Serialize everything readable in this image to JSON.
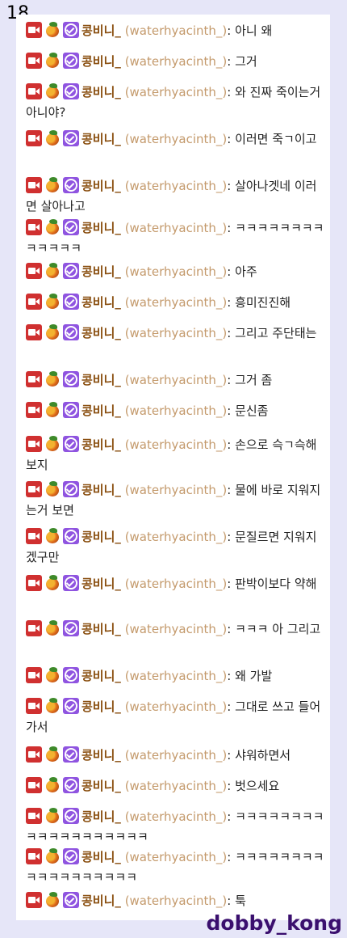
{
  "page_number": "18",
  "watermark": "dobby_kong",
  "colors": {
    "username": "#8a4f10",
    "login": "#c49a6c",
    "panel": "#ffffff",
    "background": "#e6e6f8"
  },
  "badges": [
    "camera-badge-icon",
    "fruit-badge-icon",
    "verified-badge-icon"
  ],
  "messages": [
    {
      "name": "콩비니_",
      "login": "(waterhyacinth_)",
      "text": "아니 왜"
    },
    {
      "name": "콩비니_",
      "login": "(waterhyacinth_)",
      "text": "그거"
    },
    {
      "name": "콩비니_",
      "login": "(waterhyacinth_)",
      "text": "와 진짜 죽이는거아니야?"
    },
    {
      "name": "콩비니_",
      "login": "(waterhyacinth_)",
      "text": "이러면 죽ㄱ이고"
    },
    {
      "name": "콩비니_",
      "login": "(waterhyacinth_)",
      "text": "살아나겟네 이러면 살아나고"
    },
    {
      "name": "콩비니_",
      "login": "(waterhyacinth_)",
      "text": "ㅋㅋㅋㅋㅋㅋㅋㅋㅋㅋㅋㅋㅋ"
    },
    {
      "name": "콩비니_",
      "login": "(waterhyacinth_)",
      "text": "아주"
    },
    {
      "name": "콩비니_",
      "login": "(waterhyacinth_)",
      "text": "흥미진진해"
    },
    {
      "name": "콩비니_",
      "login": "(waterhyacinth_)",
      "text": "그리고 주단태는"
    },
    {
      "name": "콩비니_",
      "login": "(waterhyacinth_)",
      "text": "그거 좀"
    },
    {
      "name": "콩비니_",
      "login": "(waterhyacinth_)",
      "text": "문신좀"
    },
    {
      "name": "콩비니_",
      "login": "(waterhyacinth_)",
      "text": "손으로 슥ㄱ슥해보지"
    },
    {
      "name": "콩비니_",
      "login": "(waterhyacinth_)",
      "text": "물에 바로 지워지는거 보면"
    },
    {
      "name": "콩비니_",
      "login": "(waterhyacinth_)",
      "text": "문질르면 지워지겠구만"
    },
    {
      "name": "콩비니_",
      "login": "(waterhyacinth_)",
      "text": "판박이보다 약해"
    },
    {
      "name": "콩비니_",
      "login": "(waterhyacinth_)",
      "text": "ㅋㅋㅋ 아 그리고"
    },
    {
      "name": "콩비니_",
      "login": "(waterhyacinth_)",
      "text": "왜 가발"
    },
    {
      "name": "콩비니_",
      "login": "(waterhyacinth_)",
      "text": "그대로 쓰고 들어가서"
    },
    {
      "name": "콩비니_",
      "login": "(waterhyacinth_)",
      "text": "샤워하면서"
    },
    {
      "name": "콩비니_",
      "login": "(waterhyacinth_)",
      "text": "벗으세요"
    },
    {
      "name": "콩비니_",
      "login": "(waterhyacinth_)",
      "text": "ㅋㅋㅋㅋㅋㅋㅋㅋㅋㅋㅋㅋㅋㅋㅋㅋㅋㅋㅋ"
    },
    {
      "name": "콩비니_",
      "login": "(waterhyacinth_)",
      "text": "ㅋㅋㅋㅋㅋㅋㅋㅋㅋㅋㅋㅋㅋㅋㅋㅋㅋㅋ"
    },
    {
      "name": "콩비니_",
      "login": "(waterhyacinth_)",
      "text": "툭"
    }
  ]
}
